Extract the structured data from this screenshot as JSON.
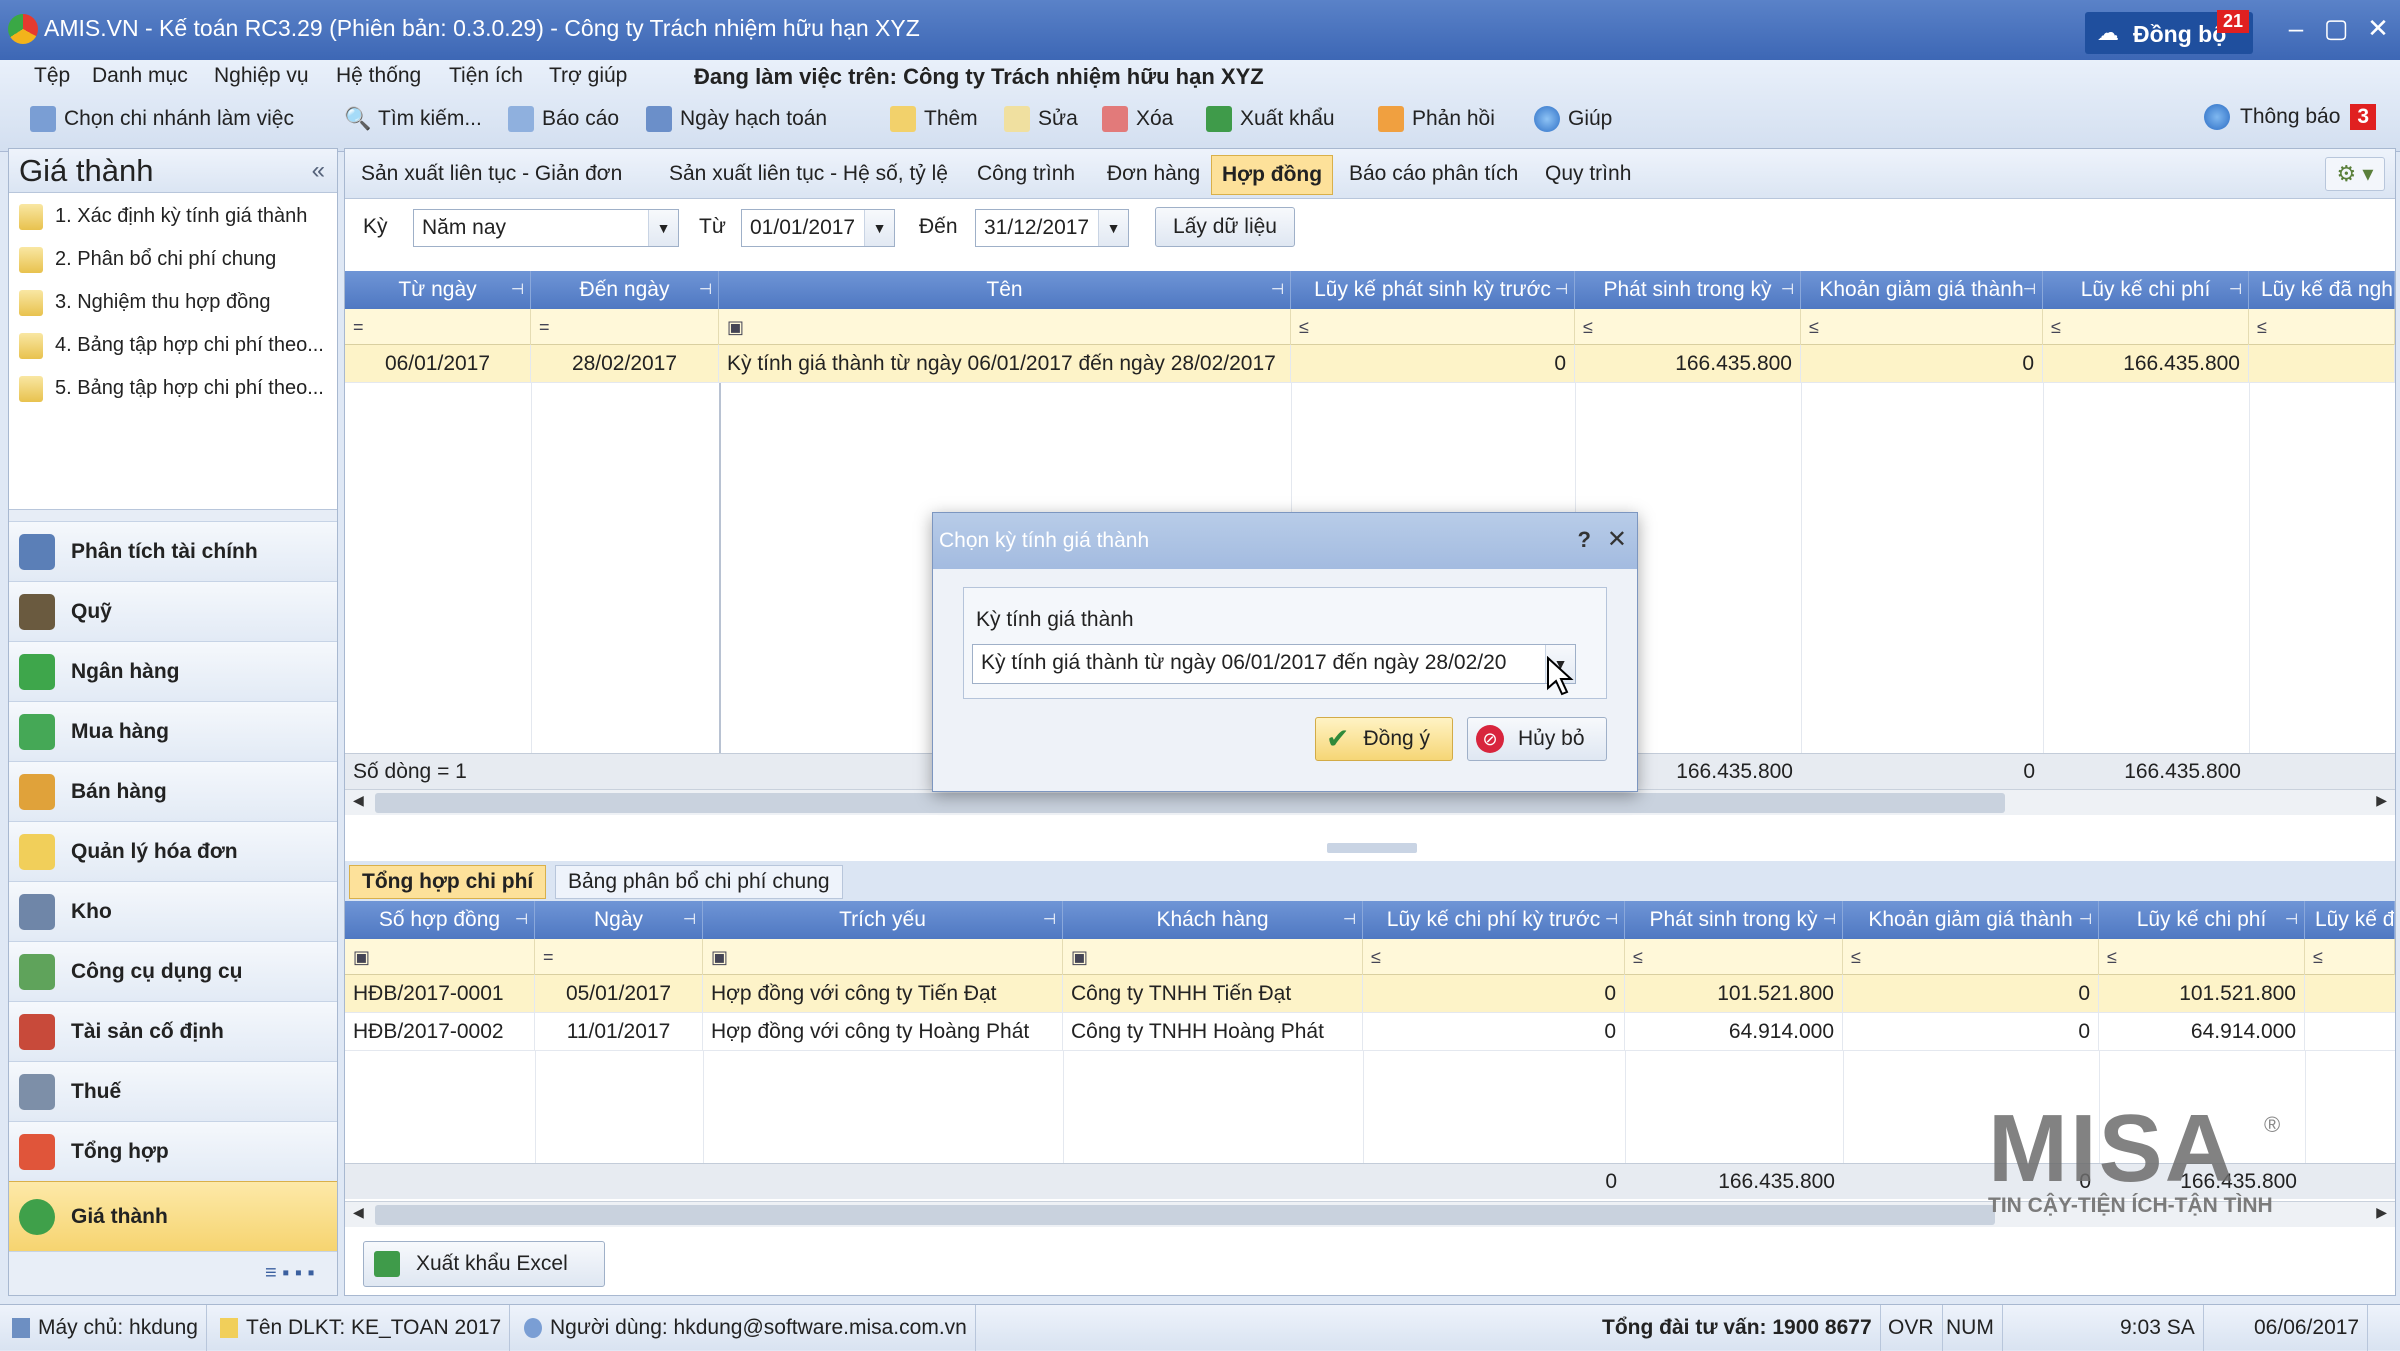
{
  "window": {
    "title": "AMIS.VN - Kế toán RC3.29 (Phiên bản: 0.3.0.29) - Công ty Trách nhiệm hữu hạn XYZ",
    "sync_label": "Đồng bộ",
    "sync_count": "21"
  },
  "menu": {
    "items": [
      "Tệp",
      "Danh mục",
      "Nghiệp vụ",
      "Hệ thống",
      "Tiện ích",
      "Trợ giúp"
    ],
    "working_on": "Đang làm việc trên:  Công ty Trách nhiệm hữu hạn XYZ",
    "notice_label": "Thông báo",
    "notice_count": "3"
  },
  "toolbar": {
    "branch": "Chọn chi nhánh làm việc",
    "search": "Tìm kiếm...",
    "report": "Báo cáo",
    "posting_date": "Ngày hạch toán",
    "add": "Thêm",
    "edit": "Sửa",
    "delete": "Xóa",
    "export": "Xuất khẩu",
    "feedback": "Phản hồi",
    "help": "Giúp"
  },
  "sidebar": {
    "title": "Giá thành",
    "tasks": [
      "1. Xác định kỳ tính giá thành",
      "2. Phân bổ chi phí chung",
      "3. Nghiệm thu hợp đồng",
      "4. Bảng tập hợp chi phí theo...",
      "5. Bảng tập hợp chi phí theo..."
    ],
    "modules": [
      "Phân tích tài chính",
      "Quỹ",
      "Ngân hàng",
      "Mua hàng",
      "Bán hàng",
      "Quản lý hóa đơn",
      "Kho",
      "Công cụ dụng cụ",
      "Tài sản cố định",
      "Thuế",
      "Tổng hợp",
      "Giá thành"
    ]
  },
  "tabs": [
    "Sản xuất liên tục - Giản đơn",
    "Sản xuất liên tục - Hệ số, tỷ lệ",
    "Công trình",
    "Đơn hàng",
    "Hợp đồng",
    "Báo cáo phân tích",
    "Quy trình"
  ],
  "filter": {
    "period_label": "Kỳ",
    "period_value": "Năm nay",
    "from_label": "Từ",
    "from_value": "01/01/2017",
    "to_label": "Đến",
    "to_value": "31/12/2017",
    "fetch_button": "Lấy dữ liệu"
  },
  "top_grid": {
    "headers": [
      "Từ ngày",
      "Đến ngày",
      "Tên",
      "Lũy kế phát sinh kỳ trước",
      "Phát sinh trong kỳ",
      "Khoản giảm giá thành",
      "Lũy kế chi phí",
      "Lũy kế đã ngh"
    ],
    "filter_ops": [
      "=",
      "=",
      "▣",
      "≤",
      "≤",
      "≤",
      "≤",
      "≤"
    ],
    "rows": [
      [
        "06/01/2017",
        "28/02/2017",
        "Kỳ tính giá thành từ ngày 06/01/2017 đến ngày 28/02/2017",
        "0",
        "166.435.800",
        "0",
        "166.435.800",
        ""
      ]
    ],
    "footer": {
      "count": "Số dòng = 1",
      "prev": "0",
      "in_period": "166.435.800",
      "reduction": "0",
      "accum": "166.435.800"
    }
  },
  "bottom_tabs": [
    "Tổng hợp chi phí",
    "Bảng phân bổ chi phí chung"
  ],
  "bottom_grid": {
    "headers": [
      "Số hợp đồng",
      "Ngày",
      "Trích yếu",
      "Khách hàng",
      "Lũy kế chi phí kỳ trước",
      "Phát sinh trong kỳ",
      "Khoản giảm giá thành",
      "Lũy kế chi phí",
      "Lũy kế đã"
    ],
    "filter_ops": [
      "▣",
      "=",
      "▣",
      "▣",
      "≤",
      "≤",
      "≤",
      "≤",
      "≤"
    ],
    "rows": [
      [
        "HĐB/2017-0001",
        "05/01/2017",
        "Hợp đồng với công ty Tiến Đạt",
        "Công ty TNHH Tiến Đạt",
        "0",
        "101.521.800",
        "0",
        "101.521.800"
      ],
      [
        "HĐB/2017-0002",
        "11/01/2017",
        "Hợp đồng với công ty Hoàng Phát",
        "Công ty TNHH Hoàng Phát",
        "0",
        "64.914.000",
        "0",
        "64.914.000"
      ]
    ],
    "footer": {
      "prev": "0",
      "in_period": "166.435.800",
      "reduction": "0",
      "accum": "166.435.800"
    }
  },
  "export_excel": "Xuất khẩu Excel",
  "dialog": {
    "title": "Chọn kỳ tính giá thành",
    "help": "?",
    "close": "✕",
    "field_label": "Kỳ tính giá thành",
    "field_value": "Kỳ tính giá thành từ ngày 06/01/2017 đến ngày 28/02/20",
    "ok": "Đồng ý",
    "cancel": "Hủy bỏ"
  },
  "watermark": {
    "brand": "MISA",
    "tagline": "TIN CẬY-TIỆN ÍCH-TẬN TÌNH",
    "reg": "®"
  },
  "status": {
    "server": "Máy chủ: hkdung",
    "db": "Tên DLKT: KE_TOAN 2017",
    "user": "Người dùng: hkdung@software.misa.com.vn",
    "hotline": "Tổng đài tư vấn: 1900 8677",
    "ovr": "OVR",
    "num": "NUM",
    "time": "9:03 SA",
    "date": "06/06/2017"
  }
}
